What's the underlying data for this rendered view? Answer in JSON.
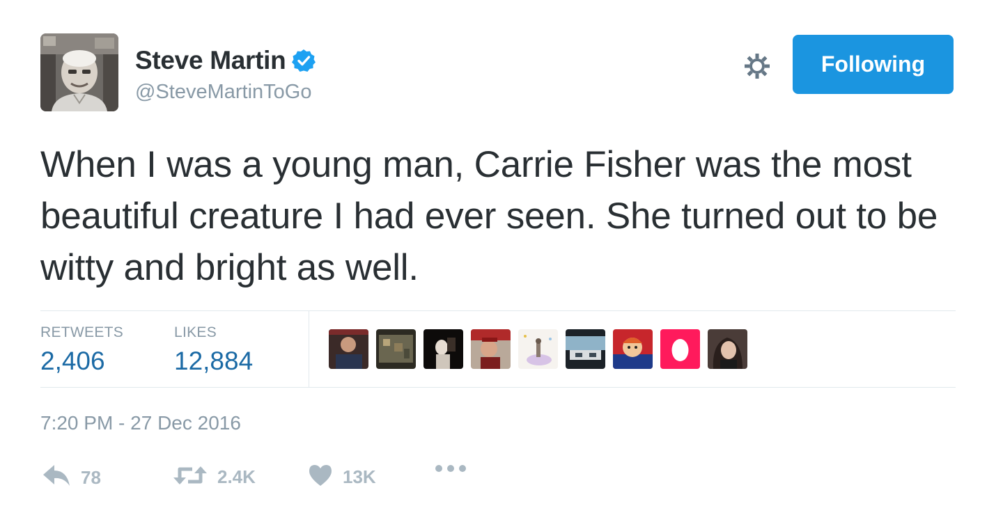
{
  "tweet": {
    "author": {
      "display_name": "Steve Martin",
      "handle": "@SteveMartinToGo",
      "verified": true
    },
    "follow_button": "Following",
    "text": "When I was a young man, Carrie Fisher was the most beautiful creature I had ever seen. She turned out to be witty and bright as well.",
    "stats": {
      "retweets_label": "RETWEETS",
      "retweets_value": "2,406",
      "likes_label": "LIKES",
      "likes_value": "12,884"
    },
    "timestamp": "7:20 PM - 27 Dec 2016",
    "actions": {
      "reply_count": "78",
      "retweet_count": "2.4K",
      "like_count": "13K"
    }
  },
  "colors": {
    "accent": "#1b95e0",
    "stat_value": "#1b6aa5",
    "muted": "#8899a6",
    "action": "#aab8c2",
    "text": "#292f33"
  },
  "icons": {
    "verified": "verified-badge-icon",
    "settings": "gear-icon",
    "reply": "reply-icon",
    "retweet": "retweet-icon",
    "like": "heart-icon",
    "more": "more-dots-icon"
  }
}
